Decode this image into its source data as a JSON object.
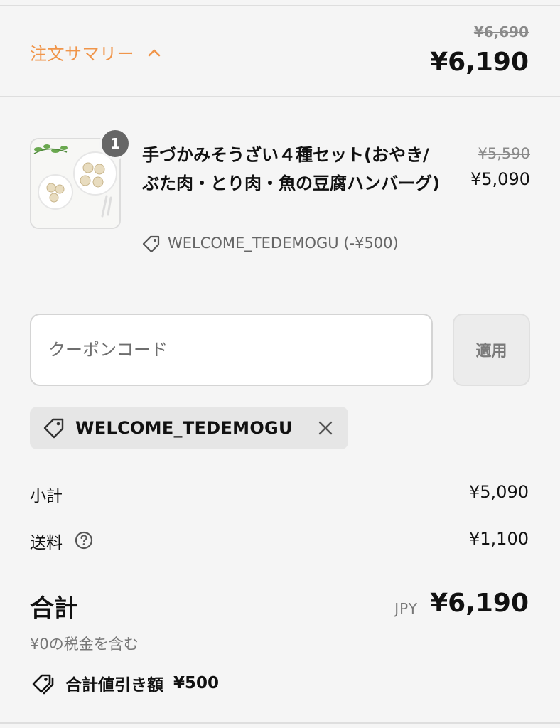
{
  "summary": {
    "toggle_label": "注文サマリー",
    "original_total": "¥6,690",
    "total": "¥6,190"
  },
  "product": {
    "quantity": "1",
    "title": "手づかみそうざい４種セット(おやき/ぶた肉・とり肉・魚の豆腐ハンバーグ)",
    "original_price": "¥5,590",
    "price": "¥5,090",
    "discount_text": "WELCOME_TEDEMOGU (-¥500)"
  },
  "coupon": {
    "placeholder": "クーポンコード",
    "apply_label": "適用",
    "applied_code": "WELCOME_TEDEMOGU"
  },
  "totals": {
    "subtotal_label": "小計",
    "subtotal_value": "¥5,090",
    "shipping_label": "送料",
    "shipping_value": "¥1,100",
    "total_label": "合計",
    "currency": "JPY",
    "total_value": "¥6,190",
    "tax_note": "¥0の税金を含む",
    "savings_label": "合計値引き額",
    "savings_value": "¥500"
  },
  "colors": {
    "accent": "#f0954a",
    "background": "#f5f5f5",
    "muted": "#777777"
  },
  "icons": [
    "chevron-up-icon",
    "tag-icon",
    "close-icon",
    "help-icon",
    "tags-icon"
  ]
}
